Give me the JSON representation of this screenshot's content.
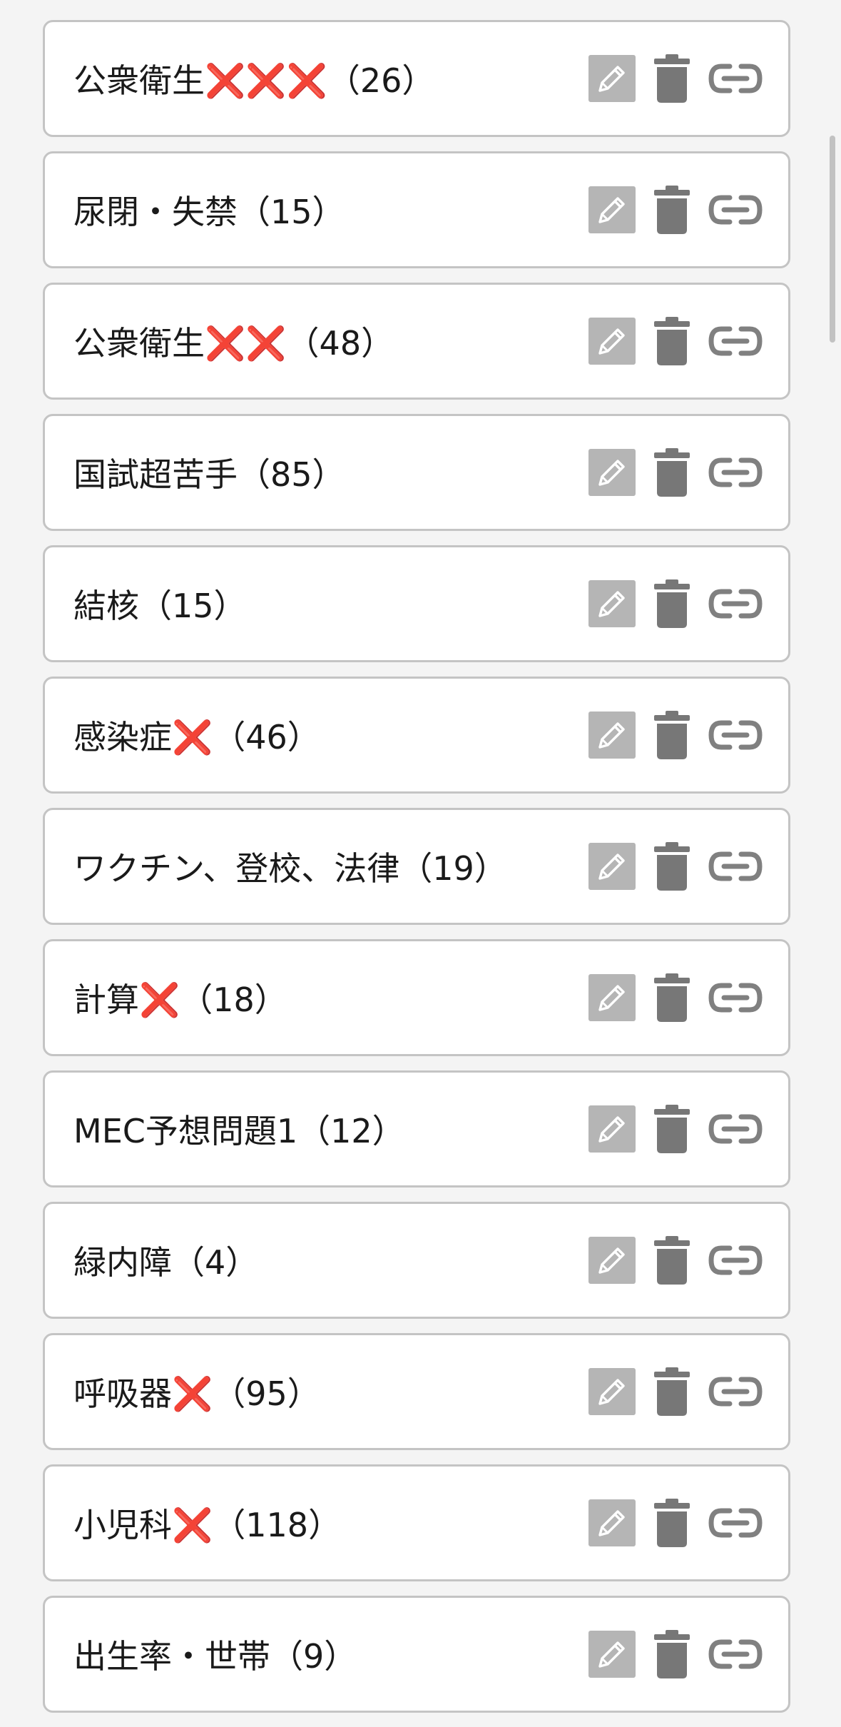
{
  "folders": [
    {
      "label": "公衆衛生❌❌❌（26）"
    },
    {
      "label": "尿閉・失禁（15）"
    },
    {
      "label": "公衆衛生❌❌（48）"
    },
    {
      "label": "国試超苦手（85）"
    },
    {
      "label": "結核（15）"
    },
    {
      "label": "感染症❌（46）"
    },
    {
      "label": "ワクチン、登校、法律（19）"
    },
    {
      "label": "計算❌（18）"
    },
    {
      "label": "MEC予想問題1（12）"
    },
    {
      "label": "緑内障（4）"
    },
    {
      "label": "呼吸器❌（95）"
    },
    {
      "label": "小児科❌（118）"
    },
    {
      "label": "出生率・世帯（9）"
    }
  ],
  "icons": {
    "edit": "pencil-icon",
    "delete": "trash-icon",
    "share": "link-icon"
  },
  "colors": {
    "edit_bg": "#b5b5b5",
    "trash": "#777777",
    "link": "#808080",
    "card_border": "#c4c4c4",
    "page_bg": "#f4f4f4"
  }
}
